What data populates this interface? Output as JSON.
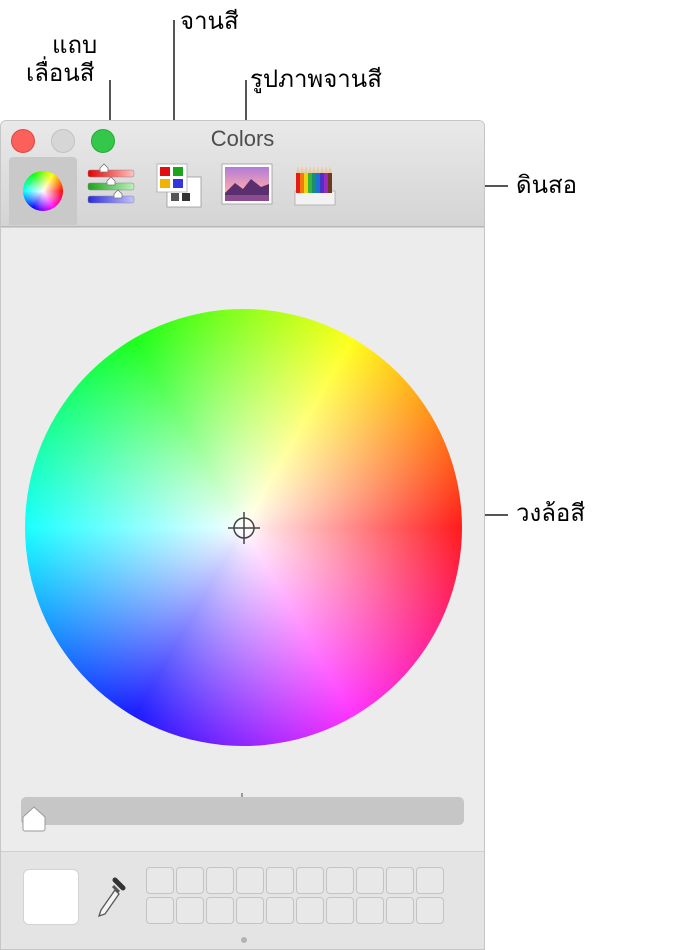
{
  "callouts": {
    "sliders_line1": "แถบ",
    "sliders_line2": "เลื่อนสี",
    "palettes": "จานสี",
    "image_palettes": "รูปภาพจานสี",
    "pencils": "ดินสอ",
    "color_wheel": "วงล้อสี"
  },
  "window": {
    "title": "Colors"
  },
  "toolbar": {
    "tabs": [
      "color-wheel",
      "color-sliders",
      "color-palettes",
      "image-palettes",
      "pencils"
    ],
    "selected": "color-wheel"
  },
  "brightness_slider": {
    "value": 0
  },
  "current_color": "#ffffff",
  "colors": {
    "close": "#fc605b",
    "zoom": "#34c84a",
    "accent_gray": "#c9c9c9"
  }
}
